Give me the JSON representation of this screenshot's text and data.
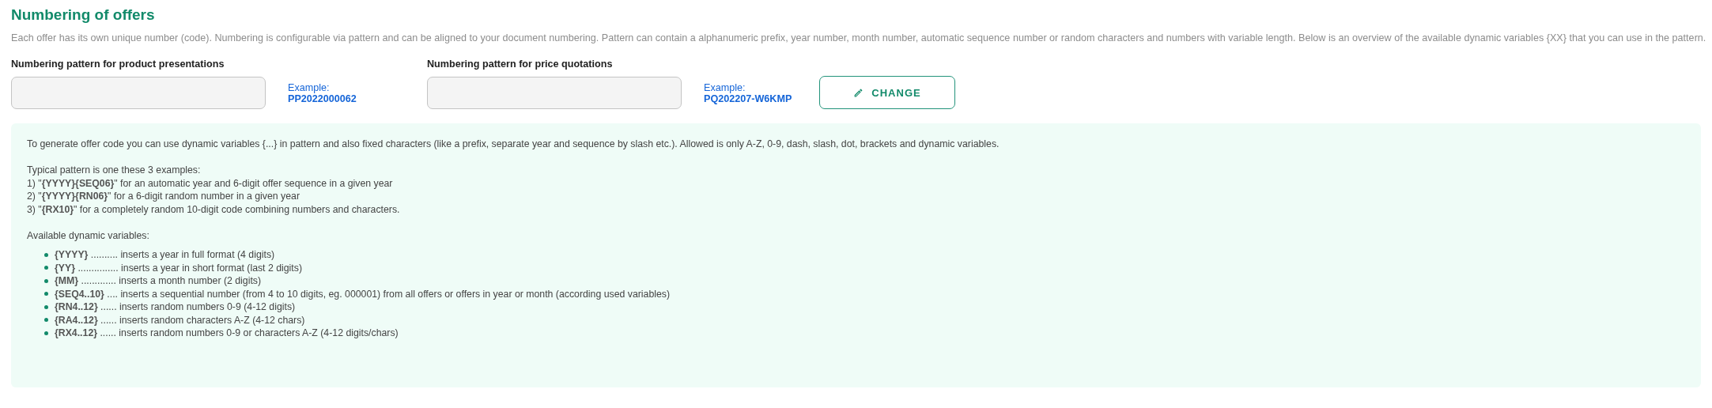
{
  "title": "Numbering of offers",
  "description": "Each offer has its own unique number (code). Numbering is configurable via pattern and can be aligned to your document numbering. Pattern can contain a alphanumeric prefix, year number, month number, automatic sequence number or random characters and numbers with variable length. Below is an overview of the available dynamic variables {XX} that you can use in the pattern.",
  "fields": [
    {
      "label": "Numbering pattern for product presentations",
      "example_label": "Example:",
      "example": "PP2022000062"
    },
    {
      "label": "Numbering pattern for price quotations",
      "example_label": "Example:",
      "example": "PQ202207-W6KMP"
    }
  ],
  "change_button": "CHANGE",
  "help": {
    "intro": "To generate offer code you can use dynamic variables {...} in pattern and also fixed characters (like a prefix, separate year and sequence by slash etc.). Allowed is only A-Z, 0-9, dash, slash, dot, brackets and dynamic variables.",
    "examples_heading": "Typical pattern is one these 3 examples:",
    "examples": [
      "1) \"**{YYYY}{SEQ06}**\" for an automatic year and 6-digit offer sequence in a given year",
      "2) \"**{YYYY}{RN06}**\" for a 6-digit random number in a given year",
      "3) \"**{RX10}**\" for a completely random 10-digit code combining numbers and characters."
    ],
    "variables_heading": "Available dynamic variables:",
    "variables": [
      "**{YYYY}** .......... inserts a year in full format (4 digits)",
      "**{YY}** ............... inserts a year in short format (last 2 digits)",
      "**{MM}** ............. inserts a month number (2 digits)",
      "**{SEQ4..10}** .... inserts a sequential number (from 4 to 10 digits, eg. 000001) from all offers or offers in year or month (according used variables)",
      "**{RN4..12}** ...... inserts random numbers 0-9 (4-12 digits)",
      "**{RA4..12}** ...... inserts random characters A-Z (4-12 chars)",
      "**{RX4..12}** ...... inserts random numbers 0-9 or characters A-Z (4-12 digits/chars)"
    ]
  }
}
